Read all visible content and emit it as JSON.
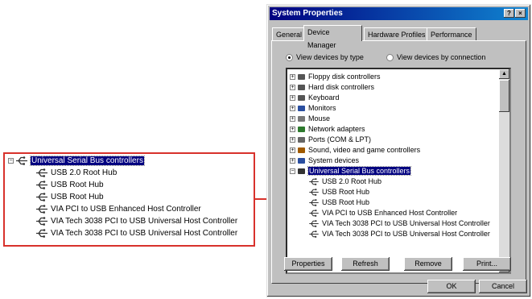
{
  "callout": {
    "root_label": "Universal Serial Bus controllers",
    "items": [
      "USB 2.0 Root Hub",
      "USB Root Hub",
      "USB Root Hub",
      "VIA PCI to USB Enhanced Host Controller",
      "VIA Tech 3038 PCI to USB Universal Host Controller",
      "VIA Tech 3038 PCI to USB Universal Host Controller"
    ]
  },
  "dialog": {
    "title": "System Properties",
    "help_button": "?",
    "close_button": "×",
    "tabs": [
      "General",
      "Device Manager",
      "Hardware Profiles",
      "Performance"
    ],
    "active_tab": "Device Manager",
    "radio_type": "View devices by type",
    "radio_connection": "View devices by connection",
    "device_categories": [
      "Floppy disk controllers",
      "Hard disk controllers",
      "Keyboard",
      "Monitors",
      "Mouse",
      "Network adapters",
      "Ports (COM & LPT)",
      "Sound, video and game controllers",
      "System devices",
      "Universal Serial Bus controllers"
    ],
    "usb_children": [
      "USB 2.0 Root Hub",
      "USB Root Hub",
      "USB Root Hub",
      "VIA PCI to USB Enhanced Host Controller",
      "VIA Tech 3038 PCI to USB Universal Host Controller",
      "VIA Tech 3038 PCI to USB Universal Host Controller"
    ],
    "buttons": {
      "properties": "Properties",
      "refresh": "Refresh",
      "remove": "Remove",
      "print": "Print...",
      "ok": "OK",
      "cancel": "Cancel"
    }
  },
  "colors": {
    "callout_border": "#d8322c",
    "selection": "#000080",
    "dialog_face": "#c0c0c0"
  }
}
